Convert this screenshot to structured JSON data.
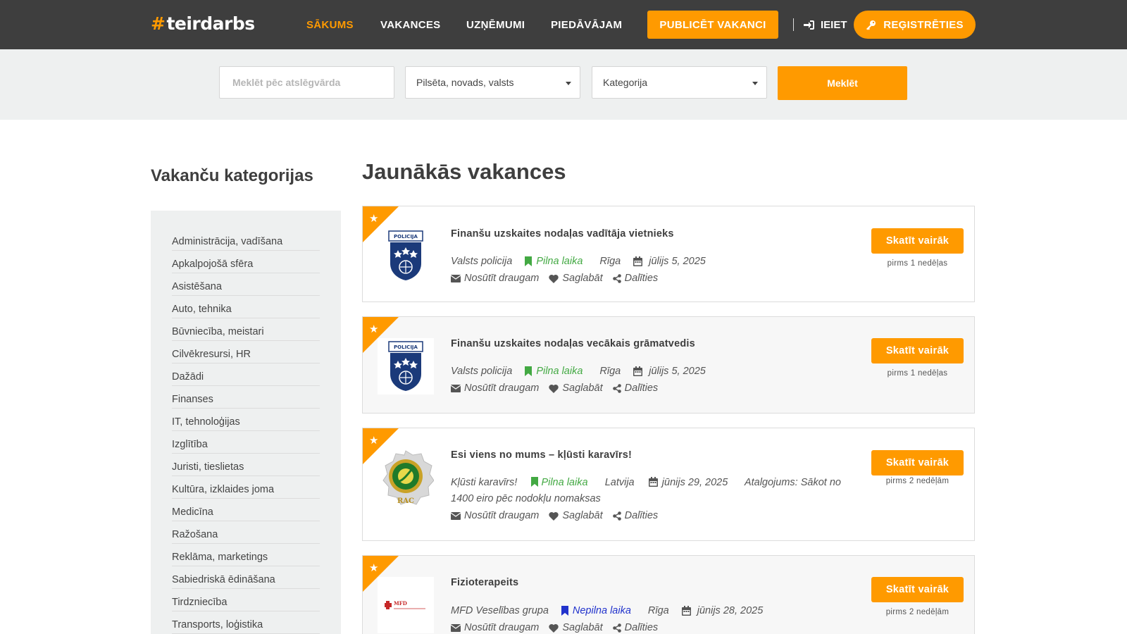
{
  "brand": {
    "hash": "#",
    "name": "teirdarbs"
  },
  "nav": {
    "items": [
      "SĀKUMS",
      "VAKANCES",
      "UZŅĒMUMI",
      "PIEDĀVĀJAM"
    ],
    "publish_label": "PUBLICĒT VAKANCI",
    "login_label": "IEIET",
    "register_label": "REĢISTRĒTIES"
  },
  "search": {
    "keyword_placeholder": "Meklēt pēc atslēgvārda",
    "location_value": "Pilsēta, novads, valsts",
    "category_value": "Kategorija",
    "button_label": "Meklēt"
  },
  "sidebar": {
    "title": "Vakanču kategorijas",
    "categories": [
      "Administrācija, vadīšana",
      "Apkalpojošā sfēra",
      "Asistēšana",
      "Auto, tehnika",
      "Būvniecība, meistari",
      "Cilvēkresursi, HR",
      "Dažādi",
      "Finanses",
      "IT, tehnoloģijas",
      "Izglītība",
      "Juristi, tieslietas",
      "Kultūra, izklaides joma",
      "Medicīna",
      "Ražošana",
      "Reklāma, marketings",
      "Sabiedriskā ēdināšana",
      "Tirdzniecība",
      "Transports, loģistika"
    ]
  },
  "main": {
    "title": "Jaunākās vakances",
    "actions": {
      "send": "Nosūtīt draugam",
      "save": "Saglabāt",
      "share": "Dalīties"
    },
    "view_more_label": "Skatīt vairāk",
    "jobs": [
      {
        "title": "Finanšu uzskaites nodaļas vadītāja vietnieks",
        "company": "Valsts policija",
        "type": "Pilna laika",
        "type_color": "#43a943",
        "location": "Rīga",
        "date": "jūlijs 5, 2025",
        "ago": "pirms 1 nedēļas",
        "logo": "police-logo"
      },
      {
        "title": "Finanšu uzskaites nodaļas vecākais grāmatvedis",
        "company": "Valsts policija",
        "type": "Pilna laika",
        "type_color": "#43a943",
        "location": "Rīga",
        "date": "jūlijs 5, 2025",
        "ago": "pirms 1 nedēļas",
        "logo": "police-logo"
      },
      {
        "title": "Esi viens no mums – kļūsti karavīrs!",
        "company": "Kļūsti karavīrs!",
        "type": "Pilna laika",
        "type_color": "#43a943",
        "location": "Latvija",
        "date": "jūnijs 29, 2025",
        "salary": "Atalgojums: Sākot no 1400 eiro pēc nodokļu nomaksas",
        "ago": "pirms 2 nedēļām",
        "logo": "army-logo",
        "logo_text": "RAC"
      },
      {
        "title": "Fizioterapeits",
        "company": "MFD Veselības grupa",
        "type": "Nepilna laika",
        "type_color": "#2233cc",
        "location": "Rīga",
        "date": "jūnijs 28, 2025",
        "ago": "pirms 2 nedēļām",
        "logo": "mfd-logo",
        "logo_text": "MFD"
      }
    ]
  },
  "colors": {
    "accent": "#ff9a00",
    "topbar": "#3e3e3e",
    "band": "#eef0f0"
  }
}
